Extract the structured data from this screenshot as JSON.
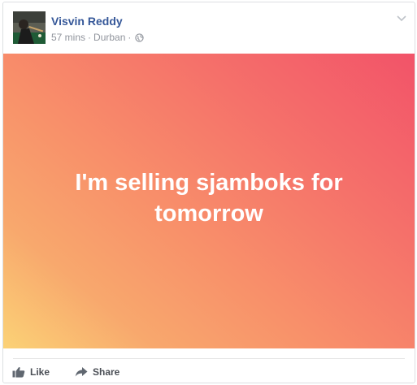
{
  "post": {
    "author": "Visvin Reddy",
    "time": "57 mins",
    "location": "Durban",
    "separator": "·",
    "privacy_icon": "globe-icon",
    "text": "I'm selling sjamboks for tomorrow",
    "background_gradient": [
      "#f25369",
      "#f8906a",
      "#fbd276"
    ]
  },
  "actions": {
    "like_label": "Like",
    "like_icon": "thumbs-up-icon",
    "share_label": "Share",
    "share_icon": "share-arrow-icon"
  },
  "colors": {
    "author_link": "#365899",
    "meta_text": "#90949c",
    "action_text": "#4b4f56"
  }
}
